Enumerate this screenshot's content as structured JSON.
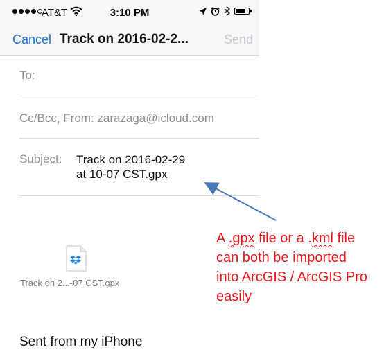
{
  "status_bar": {
    "carrier": "AT&T",
    "time": "3:10 PM",
    "battery_level": 0.85,
    "signal_bars": 4
  },
  "nav": {
    "cancel_label": "Cancel",
    "title": "Track on 2016-02-2...",
    "send_label": "Send"
  },
  "fields": {
    "to_label": "To:",
    "ccbcc_label": "Cc/Bcc, From:",
    "from_value": "zarazaga@icloud.com",
    "subject_label": "Subject:",
    "subject_line1": "Track on 2016-02-29",
    "subject_line2": "at 10-07 CST.gpx"
  },
  "attachment": {
    "name": "Track on 2...-07 CST.gpx",
    "icon": "dropbox-icon"
  },
  "body": {
    "signature": "Sent from my iPhone"
  },
  "annotation": {
    "line1_pre": "A ",
    "line1_gpx": ".gpx",
    "line1_mid": " file or a .",
    "line1_kml": "kml",
    "line1_post": " file",
    "line2": "can both be imported",
    "line3": "into ArcGIS / ArcGIS Pro",
    "line4": "easily",
    "color": "#e8171b",
    "arrow_color": "#4a79b8"
  },
  "colors": {
    "accent": "#1a73d8",
    "disabled": "#c7c7cc"
  }
}
